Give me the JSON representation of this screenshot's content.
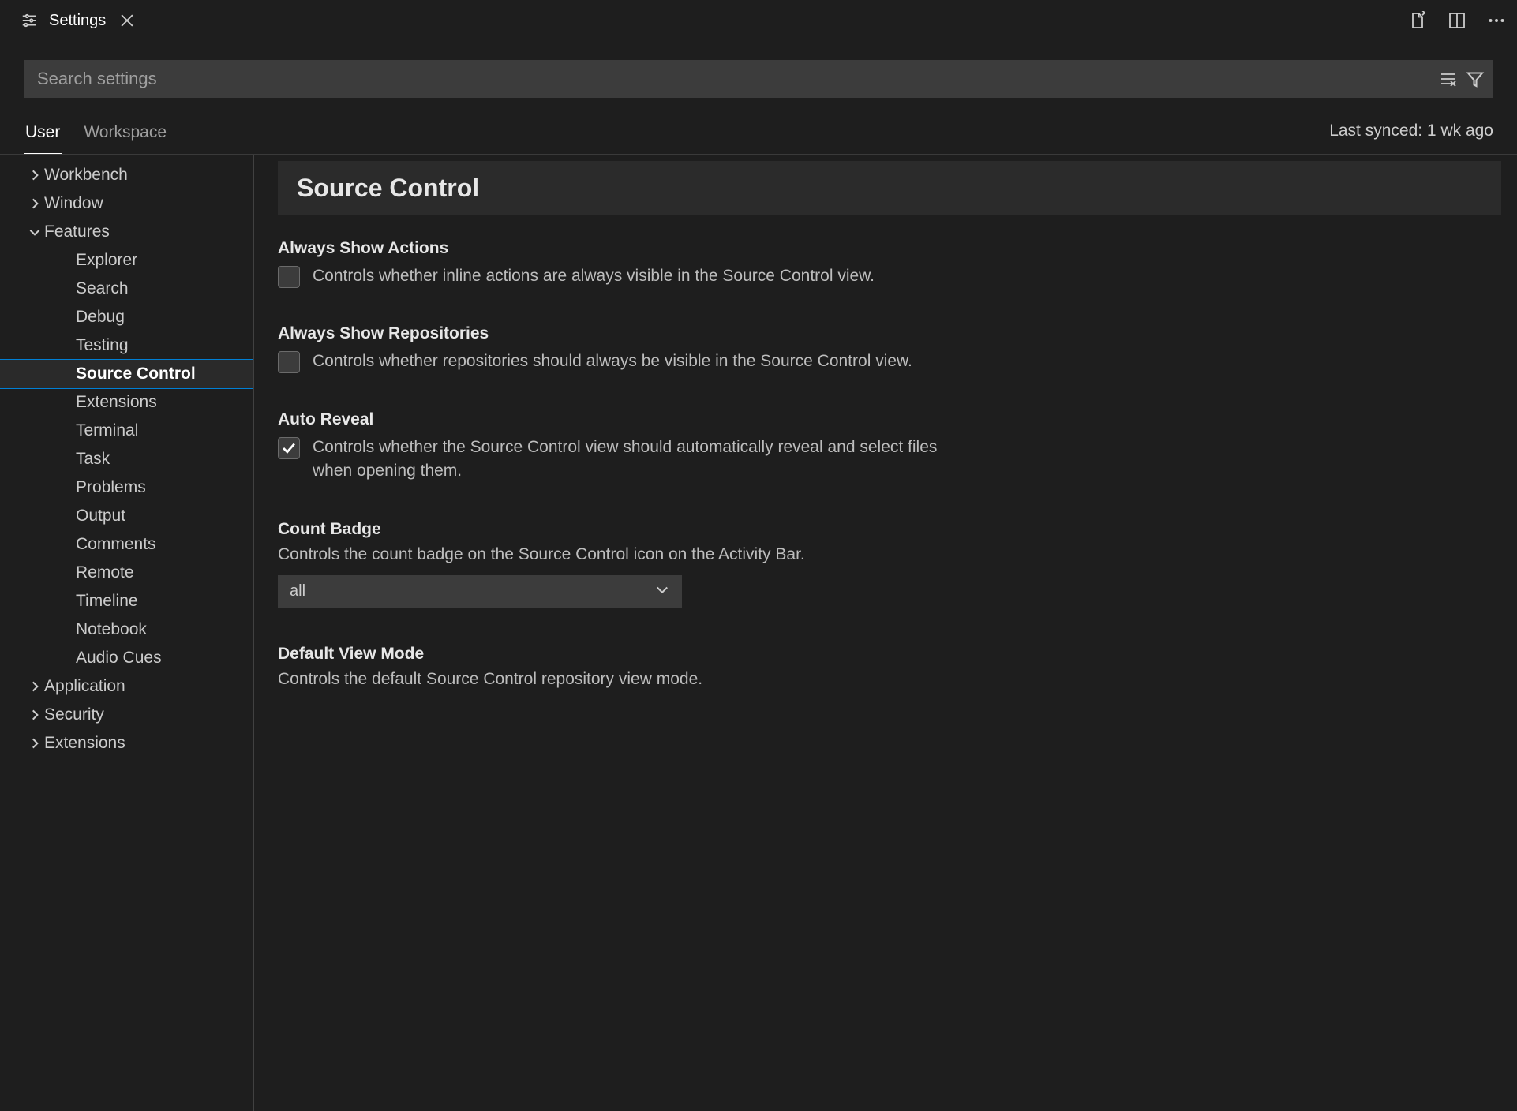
{
  "titlebar": {
    "tab_label": "Settings"
  },
  "search": {
    "placeholder": "Search settings"
  },
  "scope": {
    "tabs": [
      "User",
      "Workspace"
    ],
    "active": 0,
    "sync_status": "Last synced: 1 wk ago"
  },
  "tree": {
    "items": [
      {
        "label": "Workbench",
        "depth": 0,
        "expandable": true,
        "expanded": false
      },
      {
        "label": "Window",
        "depth": 0,
        "expandable": true,
        "expanded": false
      },
      {
        "label": "Features",
        "depth": 0,
        "expandable": true,
        "expanded": true
      },
      {
        "label": "Explorer",
        "depth": 1
      },
      {
        "label": "Search",
        "depth": 1
      },
      {
        "label": "Debug",
        "depth": 1
      },
      {
        "label": "Testing",
        "depth": 1
      },
      {
        "label": "Source Control",
        "depth": 1,
        "selected": true
      },
      {
        "label": "Extensions",
        "depth": 1
      },
      {
        "label": "Terminal",
        "depth": 1
      },
      {
        "label": "Task",
        "depth": 1
      },
      {
        "label": "Problems",
        "depth": 1
      },
      {
        "label": "Output",
        "depth": 1
      },
      {
        "label": "Comments",
        "depth": 1
      },
      {
        "label": "Remote",
        "depth": 1
      },
      {
        "label": "Timeline",
        "depth": 1
      },
      {
        "label": "Notebook",
        "depth": 1
      },
      {
        "label": "Audio Cues",
        "depth": 1
      },
      {
        "label": "Application",
        "depth": 0,
        "expandable": true,
        "expanded": false
      },
      {
        "label": "Security",
        "depth": 0,
        "expandable": true,
        "expanded": false
      },
      {
        "label": "Extensions",
        "depth": 0,
        "expandable": true,
        "expanded": false
      }
    ]
  },
  "section": {
    "title": "Source Control"
  },
  "settings": [
    {
      "title": "Always Show Actions",
      "type": "checkbox",
      "checked": false,
      "desc": "Controls whether inline actions are always visible in the Source Control view."
    },
    {
      "title": "Always Show Repositories",
      "type": "checkbox",
      "checked": false,
      "desc": "Controls whether repositories should always be visible in the Source Control view."
    },
    {
      "title": "Auto Reveal",
      "type": "checkbox",
      "checked": true,
      "desc": "Controls whether the Source Control view should automatically reveal and select files when opening them."
    },
    {
      "title": "Count Badge",
      "type": "select",
      "desc": "Controls the count badge on the Source Control icon on the Activity Bar.",
      "value": "all"
    },
    {
      "title": "Default View Mode",
      "type": "select",
      "desc": "Controls the default Source Control repository view mode.",
      "value": ""
    }
  ]
}
